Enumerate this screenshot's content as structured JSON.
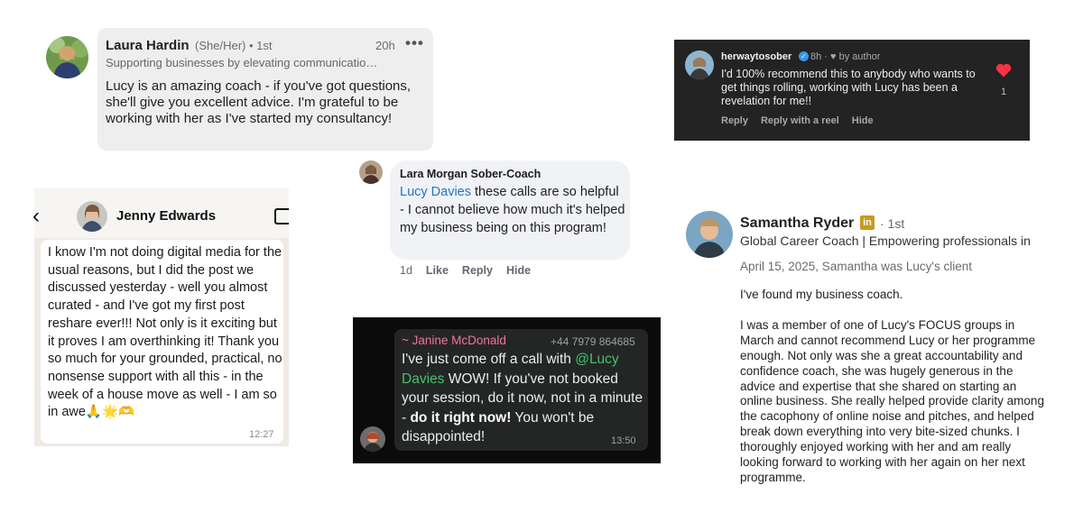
{
  "laura": {
    "name": "Laura Hardin",
    "meta": "(She/Her) • 1st",
    "time": "20h",
    "more": "•••",
    "headline": "Supporting businesses by elevating communicatio…",
    "comment": "Lucy is an amazing coach - if you've got questions, she'll give you excellent advice.  I'm grateful to be working with her as I've started my consultancy!"
  },
  "instagram": {
    "user": "herwaytosober",
    "meta": "8h · ♥ by author",
    "comment": "I'd 100% recommend this to anybody who wants to get things rolling, working with Lucy has been a revelation for me!!",
    "actions": [
      "Reply",
      "Reply with a reel",
      "Hide"
    ],
    "like_count": "1",
    "colors": {
      "heart": "#ff3040",
      "verified": "#3797f0"
    }
  },
  "lara": {
    "name": "Lara Morgan Sober-Coach",
    "mention": "Lucy Davies",
    "comment": " these calls are so helpful - I cannot believe how much it's helped my business being on this program!",
    "actions": [
      "1d",
      "Like",
      "Reply",
      "Hide"
    ]
  },
  "jenny": {
    "name": "Jenny Edwards",
    "message": "I know I'm not doing digital media for the usual reasons, but I did the post we discussed yesterday - well you almost curated - and I've got my first post reshare ever!!! Not only is it exciting but it proves I am overthinking it! Thank you so much for your grounded, practical, no nonsense support with all this - in the week of a house move as well - I am so in awe🙏🌟🫶",
    "time": "12:27"
  },
  "janine": {
    "name": "~ Janine McDonald",
    "phone": "+44 7979 864685",
    "text_before": "I've just come off a call with ",
    "mention": "@Lucy Davies",
    "text_middle": " WOW! If you've not booked your session, do it now, not in a minute - ",
    "text_bold": "do it right now!",
    "text_after": " You won't be disappointed!",
    "time": "13:50"
  },
  "samantha": {
    "name": "Samantha Ryder",
    "badge": "in",
    "degree": "· 1st",
    "headline": "Global Career Coach | Empowering professionals in",
    "relationship": "April 15, 2025, Samantha was Lucy's client",
    "paragraphs": [
      "I've found my business coach.",
      "I was a member of one of Lucy's FOCUS groups in March and cannot recommend Lucy or her programme enough. Not only was she a great accountability and confidence coach, she was hugely generous in the advice and expertise that she shared on starting an online business.  She really helped provide clarity among the cacophony of online noise and pitches, and helped break down everything into very bite-sized chunks. I thoroughly enjoyed working with her and am really looking forward to working with her again on her next programme."
    ]
  }
}
